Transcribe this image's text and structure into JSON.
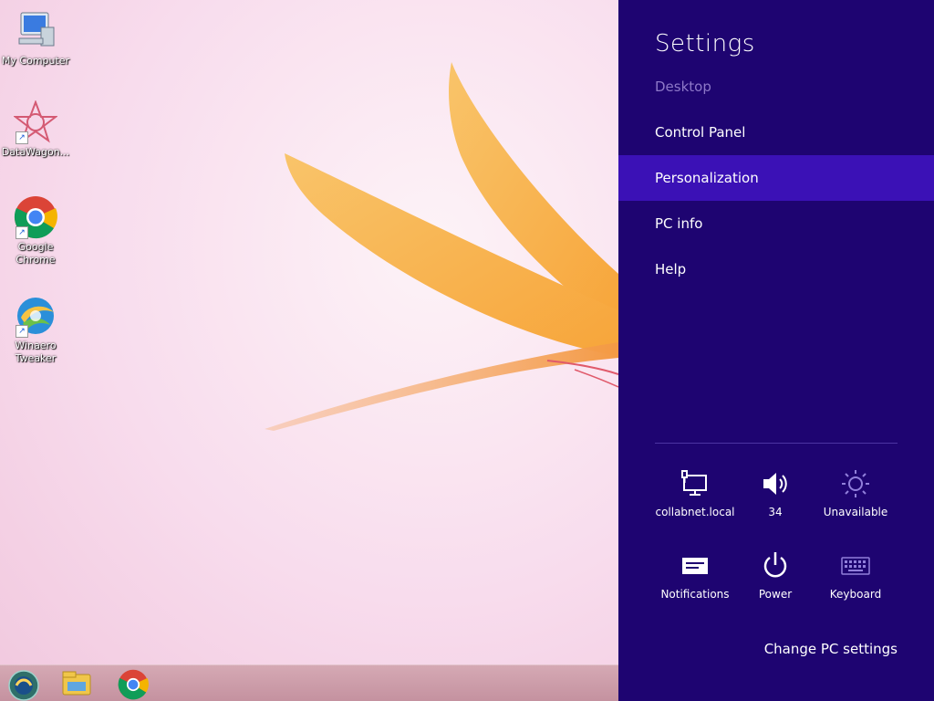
{
  "desktop": {
    "icons": [
      {
        "label": "My Computer",
        "icon": "computer-icon"
      },
      {
        "label": "DataWagon...",
        "icon": "datawagon-icon"
      },
      {
        "label": "Google Chrome",
        "icon": "chrome-icon"
      },
      {
        "label": "Winaero Tweaker",
        "icon": "winaero-tweaker-icon"
      }
    ]
  },
  "taskbar": {
    "items": [
      {
        "name": "start-orb-icon"
      },
      {
        "name": "file-explorer-icon"
      },
      {
        "name": "chrome-icon"
      }
    ]
  },
  "charm": {
    "title": "Settings",
    "background": "#1e0471",
    "accent": "#3b11b6",
    "menu": [
      {
        "label": "Desktop",
        "state": "disabled"
      },
      {
        "label": "Control Panel",
        "state": "normal"
      },
      {
        "label": "Personalization",
        "state": "selected"
      },
      {
        "label": "PC info",
        "state": "normal"
      },
      {
        "label": "Help",
        "state": "normal"
      }
    ],
    "quick": [
      {
        "label": "collabnet.local",
        "icon": "network-icon"
      },
      {
        "label": "34",
        "icon": "volume-icon"
      },
      {
        "label": "Unavailable",
        "icon": "brightness-icon"
      },
      {
        "label": "Notifications",
        "icon": "notifications-icon"
      },
      {
        "label": "Power",
        "icon": "power-icon"
      },
      {
        "label": "Keyboard",
        "icon": "keyboard-icon"
      }
    ],
    "change_pc_settings": "Change PC settings"
  }
}
